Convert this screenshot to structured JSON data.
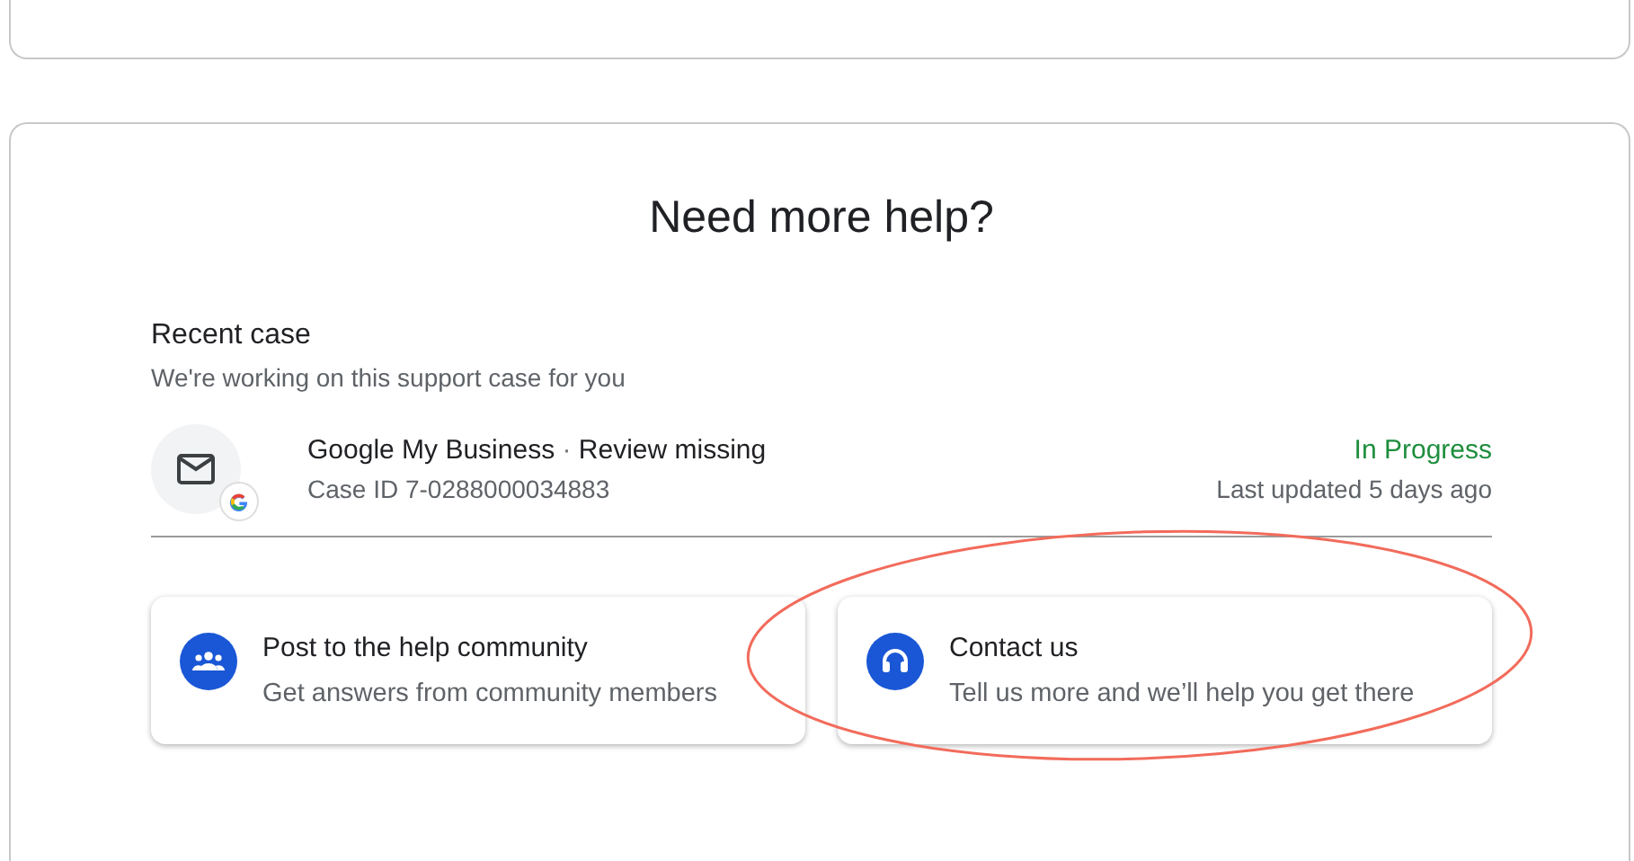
{
  "title": "Need more help?",
  "recent_case": {
    "heading": "Recent case",
    "subtitle": "We're working on this support case for you",
    "product": "Google My Business",
    "separator": "·",
    "issue": "Review missing",
    "case_id": "Case ID 7-0288000034883",
    "status": "In Progress",
    "updated": "Last updated 5 days ago"
  },
  "options": [
    {
      "kind": "community",
      "title": "Post to the help community",
      "description": "Get answers from community members",
      "highlighted": false
    },
    {
      "kind": "contact",
      "title": "Contact us",
      "description": "Tell us more and we’ll help you get there",
      "highlighted": true
    }
  ]
}
